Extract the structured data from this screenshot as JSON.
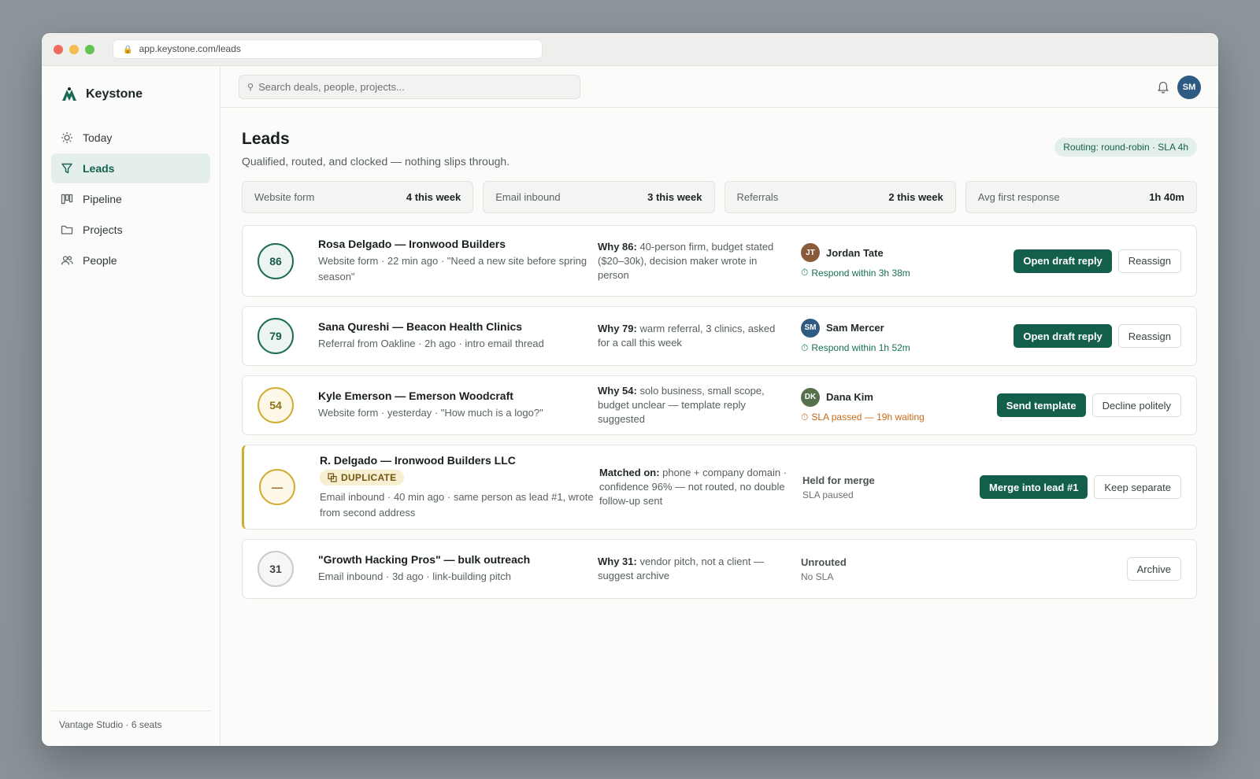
{
  "browser": {
    "url": "app.keystone.com/leads"
  },
  "brand": {
    "name": "Keystone"
  },
  "nav": [
    {
      "label": "Today",
      "icon": "sun-icon"
    },
    {
      "label": "Leads",
      "icon": "filter-icon",
      "active": true
    },
    {
      "label": "Pipeline",
      "icon": "kanban-icon"
    },
    {
      "label": "Projects",
      "icon": "folder-icon"
    },
    {
      "label": "People",
      "icon": "people-icon"
    }
  ],
  "sidebar_footer": "Vantage Studio · 6 seats",
  "search": {
    "placeholder": "Search deals, people, projects..."
  },
  "user": {
    "initials": "SM"
  },
  "page": {
    "title": "Leads",
    "subtitle": "Qualified, routed, and clocked — nothing slips through.",
    "routing": "Routing: round-robin · SLA 4h"
  },
  "stats": [
    {
      "label": "Website form",
      "value": "4 this week"
    },
    {
      "label": "Email inbound",
      "value": "3 this week"
    },
    {
      "label": "Referrals",
      "value": "2 this week"
    },
    {
      "label": "Avg first response",
      "value": "1h 40m"
    }
  ],
  "leads": [
    {
      "score": "86",
      "name": "Rosa Delgado — Ironwood Builders",
      "meta": "Website form · 22 min ago · \"Need a new site before spring season\"",
      "why_label": "Why 86:",
      "why_text": " 40-person firm, budget stated ($20–30k), decision maker wrote in person",
      "owner_initials": "JT",
      "owner_name": "Jordan Tate",
      "sla": "Respond within 3h 38m",
      "primary": "Open draft reply",
      "secondary": "Reassign"
    },
    {
      "score": "79",
      "name": "Sana Qureshi — Beacon Health Clinics",
      "meta": "Referral from Oakline · 2h ago · intro email thread",
      "why_label": "Why 79:",
      "why_text": " warm referral, 3 clinics, asked for a call this week",
      "owner_initials": "SM",
      "owner_name": "Sam Mercer",
      "sla": "Respond within 1h 52m",
      "primary": "Open draft reply",
      "secondary": "Reassign"
    },
    {
      "score": "54",
      "name": "Kyle Emerson — Emerson Woodcraft",
      "meta": "Website form · yesterday · \"How much is a logo?\"",
      "why_label": "Why 54:",
      "why_text": " solo business, small scope, budget unclear — template reply suggested",
      "owner_initials": "DK",
      "owner_name": "Dana Kim",
      "sla": "SLA passed — 19h waiting",
      "primary": "Send template",
      "secondary": "Decline politely"
    },
    {
      "score": "—",
      "name": "R. Delgado — Ironwood Builders LLC",
      "badge": "DUPLICATE",
      "meta": "Email inbound · 40 min ago · same person as lead #1, wrote from second address",
      "why_label": "Matched on:",
      "why_text": " phone + company domain · confidence 96% — not routed, no double follow-up sent",
      "hold_title": "Held for merge",
      "hold_sub": "SLA paused",
      "primary": "Merge into lead #1",
      "secondary": "Keep separate"
    },
    {
      "score": "31",
      "name": "\"Growth Hacking Pros\" — bulk outreach",
      "meta": "Email inbound · 3d ago · link-building pitch",
      "why_label": "Why 31:",
      "why_text": " vendor pitch, not a client — suggest archive",
      "hold_title": "Unrouted",
      "hold_sub": "No SLA",
      "secondary": "Archive"
    }
  ],
  "colors": {
    "accent": "#145f4c",
    "accent_soft": "#e4efec",
    "amber": "#d2ac32",
    "late": "#c46a17",
    "avatar_jt": "#8a5a3c",
    "avatar_sm": "#2f5b82",
    "avatar_dk": "#55704a"
  }
}
